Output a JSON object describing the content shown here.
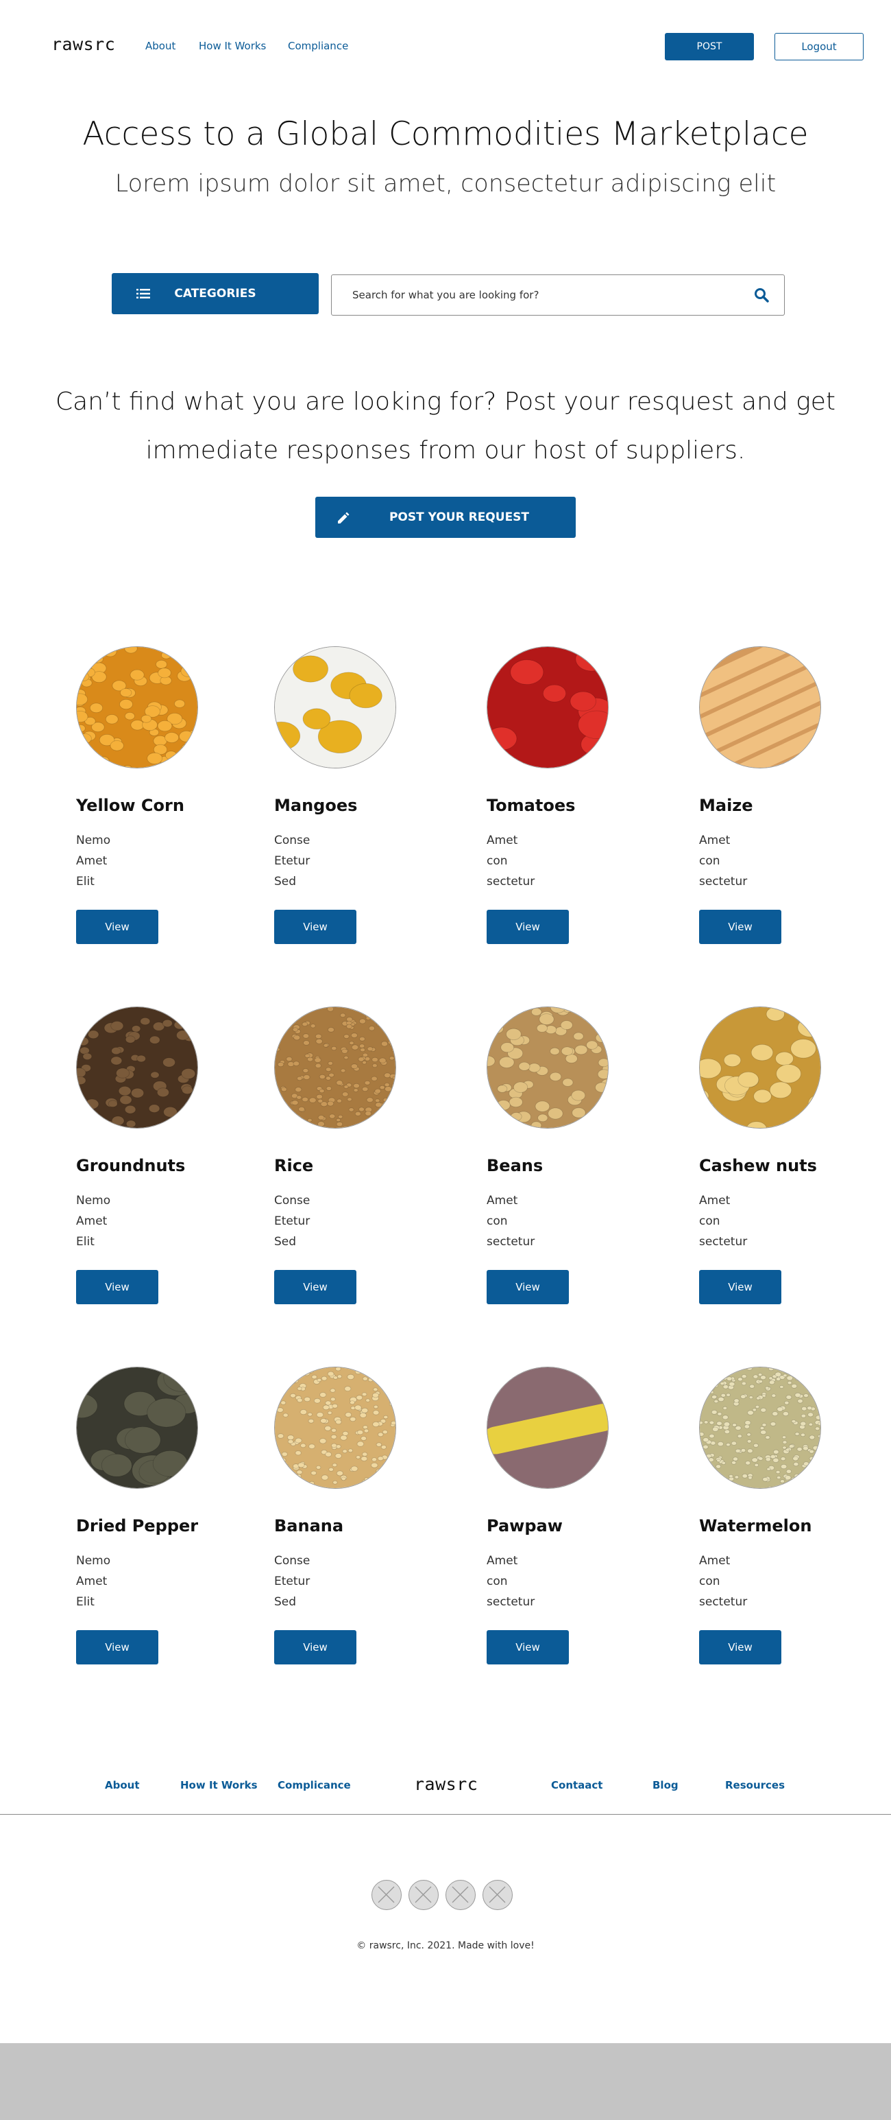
{
  "nav": {
    "logo": "rawsrc",
    "links": [
      "About",
      "How It Works",
      "Compliance"
    ],
    "post_label": "POST",
    "logout_label": "Logout"
  },
  "hero": {
    "title": "Access to a Global Commodities Marketplace",
    "subtitle": "Lorem ipsum dolor sit amet, consectetur adipiscing elit"
  },
  "search": {
    "categories_label": "CATEGORIES",
    "placeholder": "Search for what you are looking for?"
  },
  "cta": {
    "line1": "Can’t find what you are looking for? Post your resquest and get",
    "line2": "immediate responses from our host of suppliers.",
    "button_label": "POST YOUR REQUEST"
  },
  "products": [
    {
      "name": "Yellow Corn",
      "lines": [
        "Nemo",
        "Amet",
        "Elit"
      ],
      "view": "View",
      "image": "yellow-corn-image"
    },
    {
      "name": "Mangoes",
      "lines": [
        "Conse",
        "Etetur",
        "Sed"
      ],
      "view": "View",
      "image": "mangoes-image"
    },
    {
      "name": "Tomatoes",
      "lines": [
        "Amet",
        "con",
        "sectetur"
      ],
      "view": "View",
      "image": "tomatoes-image"
    },
    {
      "name": "Maize",
      "lines": [
        "Amet",
        "con",
        "sectetur"
      ],
      "view": "View",
      "image": "maize-image"
    },
    {
      "name": "Groundnuts",
      "lines": [
        "Nemo",
        "Amet",
        "Elit"
      ],
      "view": "View",
      "image": "groundnuts-image"
    },
    {
      "name": "Rice",
      "lines": [
        "Conse",
        "Etetur",
        "Sed"
      ],
      "view": "View",
      "image": "rice-image"
    },
    {
      "name": "Beans",
      "lines": [
        "Amet",
        "con",
        "sectetur"
      ],
      "view": "View",
      "image": "beans-image"
    },
    {
      "name": "Cashew nuts",
      "lines": [
        "Amet",
        "con",
        "sectetur"
      ],
      "view": "View",
      "image": "cashew-nuts-image"
    },
    {
      "name": "Dried Pepper",
      "lines": [
        "Nemo",
        "Amet",
        "Elit"
      ],
      "view": "View",
      "image": "dried-pepper-image"
    },
    {
      "name": "Banana",
      "lines": [
        "Conse",
        "Etetur",
        "Sed"
      ],
      "view": "View",
      "image": "banana-image"
    },
    {
      "name": "Pawpaw",
      "lines": [
        "Amet",
        "con",
        "sectetur"
      ],
      "view": "View",
      "image": "pawpaw-image"
    },
    {
      "name": "Watermelon",
      "lines": [
        "Amet",
        "con",
        "sectetur"
      ],
      "view": "View",
      "image": "watermelon-image"
    }
  ],
  "footer": {
    "left_links": [
      "About",
      "How It Works",
      "Complicance"
    ],
    "logo": "rawsrc",
    "right_links": [
      "Contaact",
      "Blog",
      "Resources"
    ],
    "social_icons": [
      "social-icon-1",
      "social-icon-2",
      "social-icon-3",
      "social-icon-4"
    ],
    "copyright": "© rawsrc, Inc. 2021. Made with love!"
  },
  "colors": {
    "primary": "#0b5b97",
    "footer_band": "#c4c4c4"
  }
}
